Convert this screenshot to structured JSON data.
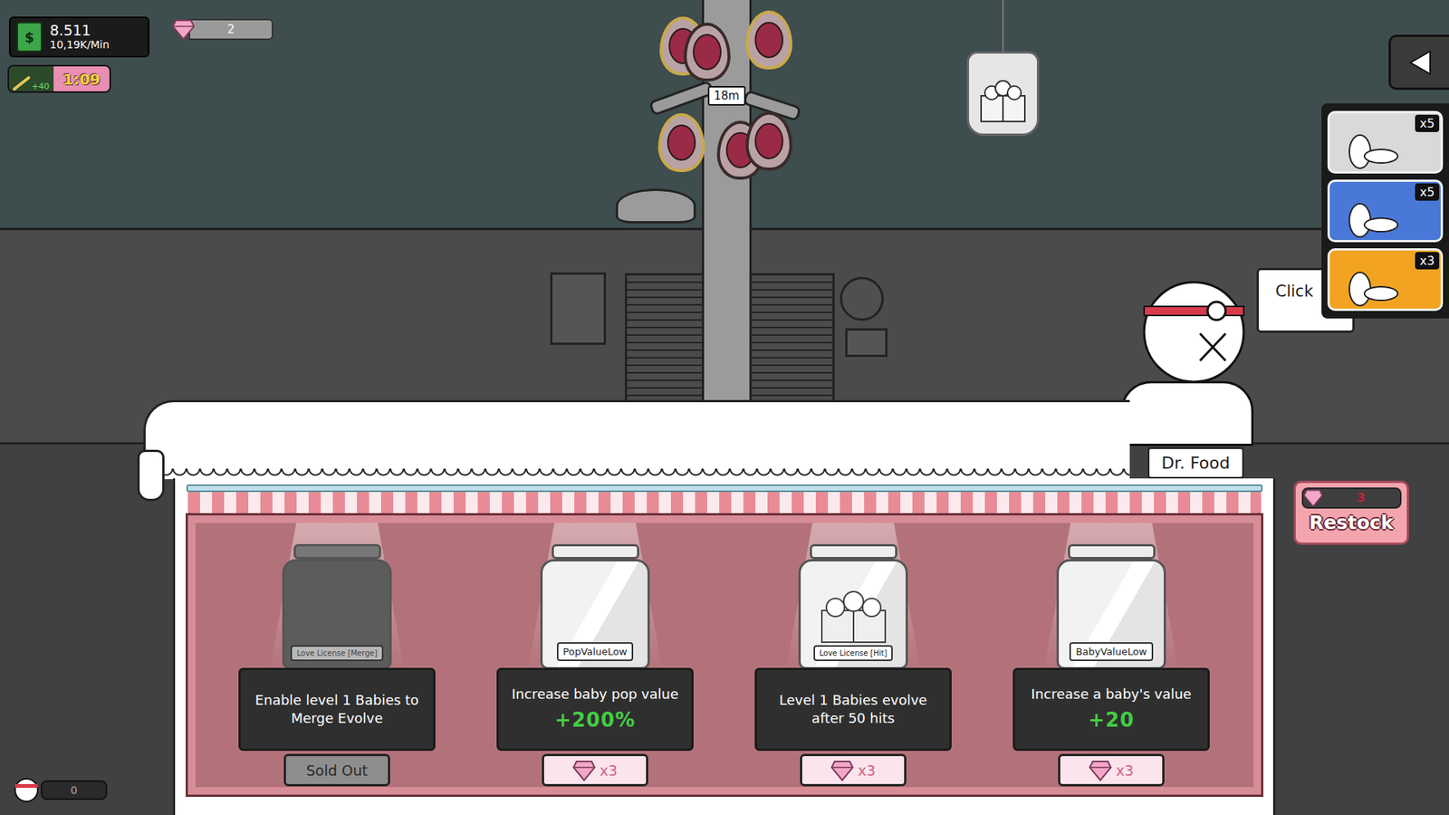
{
  "hud": {
    "money_icon": "$",
    "money": "8.511",
    "rate": "10,19K/Min",
    "boost": "+40",
    "timer": "1:09",
    "gems": "2"
  },
  "tree": {
    "height": "18m"
  },
  "boosters": [
    {
      "count": "x5",
      "color": "#d9d9d9"
    },
    {
      "count": "x5",
      "color": "#4a78d8"
    },
    {
      "count": "x3",
      "color": "#f2a322"
    }
  ],
  "bubble": {
    "text": "Click"
  },
  "npc": {
    "name": "Dr. Food"
  },
  "shop": {
    "items": [
      {
        "label": "Love License [Merge]",
        "description": "Enable level 1 Babies to Merge Evolve",
        "price": "Sold Out",
        "sold_out": true,
        "kind": "plain"
      },
      {
        "label": "PopValueLow",
        "description": "Increase baby pop value",
        "bonus": "+200%",
        "price": "x3",
        "sold_out": false,
        "kind": "plain"
      },
      {
        "label": "Love License [Hit]",
        "description": "Level 1 Babies evolve after 50 hits",
        "price": "x3",
        "sold_out": false,
        "kind": "gift"
      },
      {
        "label": "BabyValueLow",
        "description": "Increase a baby's value",
        "bonus": "+20",
        "price": "x3",
        "sold_out": false,
        "kind": "plain"
      }
    ]
  },
  "restock": {
    "label": "Restock",
    "cost": "3"
  },
  "player": {
    "level_text": "0",
    "level": 0
  }
}
